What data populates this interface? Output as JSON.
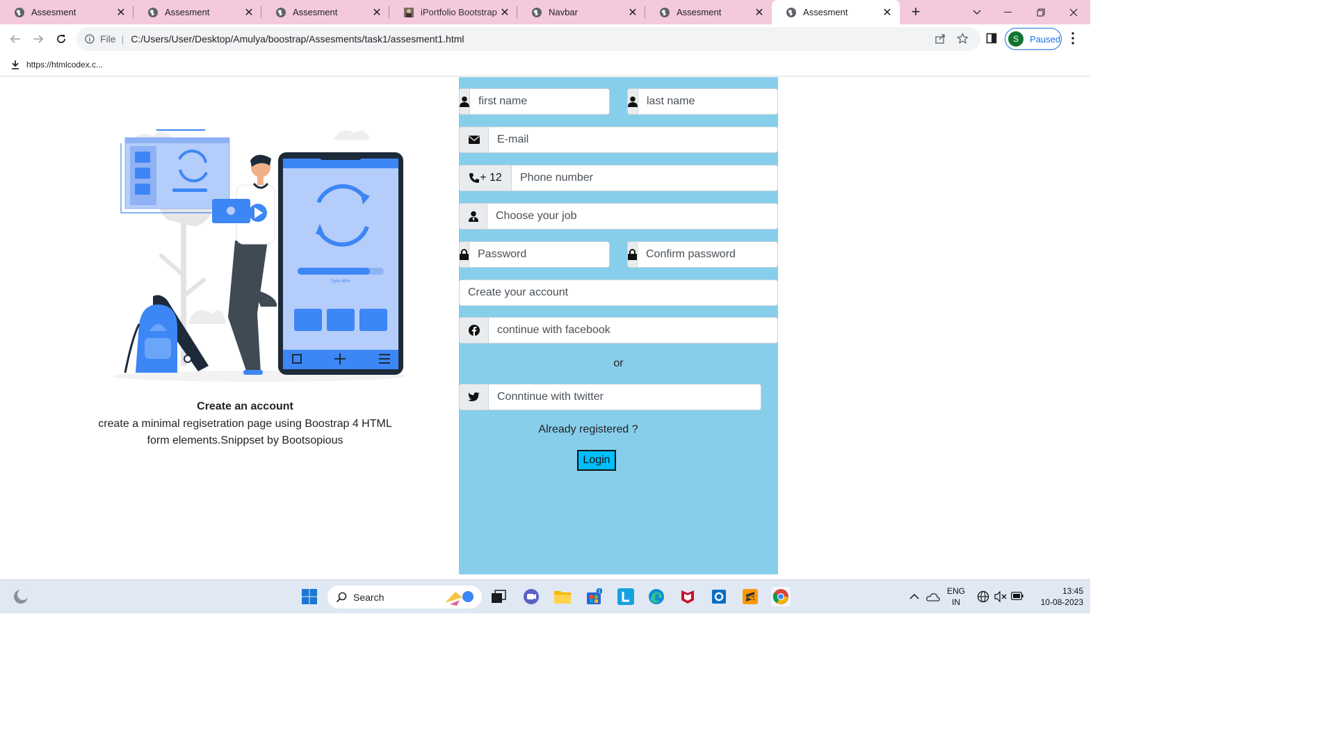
{
  "browser": {
    "tabs": [
      {
        "title": "Assesment",
        "close": "✕",
        "active": false
      },
      {
        "title": "Assesment",
        "close": "✕",
        "active": false
      },
      {
        "title": "Assesment",
        "close": "✕",
        "active": false
      },
      {
        "title": "iPortfolio Bootstrap Te",
        "close": "✕",
        "active": false
      },
      {
        "title": "Navbar",
        "close": "✕",
        "active": false
      },
      {
        "title": "Assesment",
        "close": "✕",
        "active": false
      },
      {
        "title": "Assesment",
        "close": "✕",
        "active": true
      }
    ],
    "new_tab": "+",
    "address": {
      "scheme_label": "File",
      "url": "C:/Users/User/Desktop/Amulya/boostrap/Assesments/task1/assesment1.html"
    },
    "profile": {
      "initial": "S",
      "status": "Paused"
    },
    "download_item": "https://htmlcodex.c..."
  },
  "page": {
    "caption": {
      "heading": "Create an account",
      "line1": "create a minimal regisetration page using Boostrap 4 HTML",
      "line2": "form elements.Snippset by Bootsopious"
    },
    "illustration": {
      "sync_text": "Sync 80%"
    },
    "form": {
      "first_name_placeholder": "first name",
      "last_name_placeholder": "last name",
      "email_placeholder": "E-mail",
      "phone_code": "+ 12",
      "phone_placeholder": "Phone number",
      "job_placeholder": "Choose your job",
      "password_placeholder": "Password",
      "confirm_password_placeholder": "Confirm password",
      "create_account_placeholder": "Create your account",
      "facebook_placeholder": "continue with facebook",
      "or_text": "or",
      "twitter_placeholder": "Conntinue with twitter",
      "already_registered": "Already registered ?",
      "login_label": "Login"
    }
  },
  "taskbar": {
    "search_label": "Search",
    "store_badge": "1",
    "language": "ENG",
    "region": "IN",
    "time": "13:45",
    "date": "10-08-2023"
  },
  "colors": {
    "tab_strip": "#f4c9dc",
    "form_panel": "#87ceeb",
    "login_button": "#00bfff",
    "illustration_blue": "#3d86f5"
  }
}
